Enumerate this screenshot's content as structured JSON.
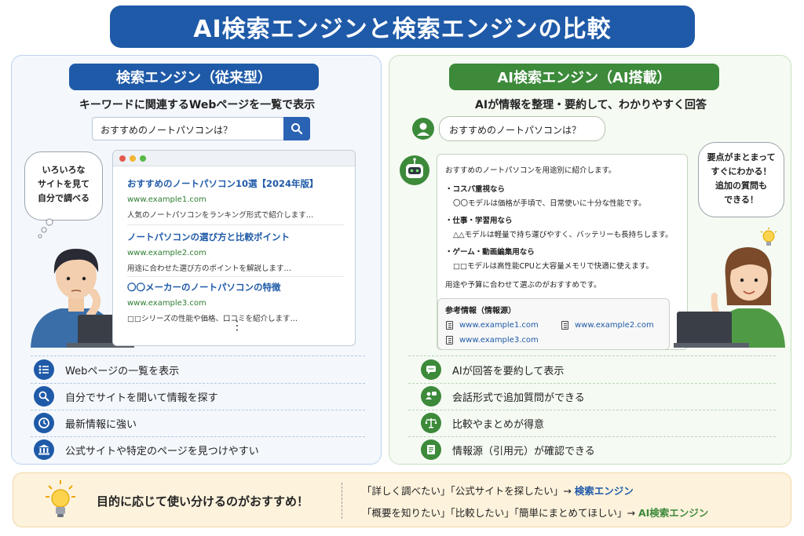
{
  "title": "AI検索エンジンと検索エンジンの比較",
  "left": {
    "heading": "検索エンジン（従来型）",
    "subtitle": "キーワードに関連するWebページを一覧で表示",
    "search_query": "おすすめのノートパソコンは？",
    "bubble": [
      "いろいろな",
      "サイトを見て",
      "自分で調べる"
    ],
    "results": [
      {
        "title": "おすすめのノートパソコン10選【2024年版】",
        "url": "www.example1.com",
        "desc": "人気のノートパソコンをランキング形式で紹介します…"
      },
      {
        "title": "ノートパソコンの選び方と比較ポイント",
        "url": "www.example2.com",
        "desc": "用途に合わせた選び方のポイントを解説します…"
      },
      {
        "title": "〇〇メーカーのノートパソコンの特徴",
        "url": "www.example3.com",
        "desc": "□□シリーズの性能や価格、口コミを紹介します…"
      }
    ],
    "more_glyph": "⋮",
    "features": [
      {
        "icon": "list-icon",
        "text": "Webページの一覧を表示"
      },
      {
        "icon": "search-icon",
        "text": "自分でサイトを開いて情報を探す"
      },
      {
        "icon": "clock-icon",
        "text": "最新情報に強い"
      },
      {
        "icon": "building-icon",
        "text": "公式サイトや特定のページを見つけやすい"
      }
    ]
  },
  "right": {
    "heading": "AI検索エンジン（AI搭載）",
    "subtitle": "AIが情報を整理・要約して、わかりやすく回答",
    "user_question": "おすすめのノートパソコンは？",
    "bubble": [
      "要点がまとまって",
      "すぐにわかる！",
      "追加の質問も",
      "できる！"
    ],
    "answer": {
      "intro": "おすすめのノートパソコンを用途別に紹介します。",
      "sections": [
        {
          "head": "・コスパ重視なら",
          "body": "〇〇モデルは価格が手頃で、日常使いに十分な性能です。"
        },
        {
          "head": "・仕事・学習用なら",
          "body": "△△モデルは軽量で持ち運びやすく、バッテリーも長持ちします。"
        },
        {
          "head": "・ゲーム・動画編集用なら",
          "body": "□□モデルは高性能CPUと大容量メモリで快適に使えます。"
        }
      ],
      "closing": "用途や予算に合わせて選ぶのがおすすめです。",
      "sources_title": "参考情報（情報源）",
      "sources": [
        "www.example1.com",
        "www.example2.com",
        "www.example3.com"
      ]
    },
    "features": [
      {
        "icon": "chat-icon",
        "text": "AIが回答を要約して表示"
      },
      {
        "icon": "conversation-icon",
        "text": "会話形式で追加質問ができる"
      },
      {
        "icon": "scale-icon",
        "text": "比較やまとめが得意"
      },
      {
        "icon": "document-icon",
        "text": "情報源（引用元）が確認できる"
      }
    ]
  },
  "banner": {
    "main": "目的に応じて使い分けるのがおすすめ！",
    "line1_prefix": "「詳しく調べたい」「公式サイトを探したい」→",
    "line1_target": "検索エンジン",
    "line2_prefix": "「概要を知りたい」「比較したい」「簡単にまとめてほしい」→",
    "line2_target": "AI検索エンジン"
  },
  "colors": {
    "primary_blue": "#1f5aa8",
    "primary_green": "#3c8a3a",
    "banner_bg": "#fdf2dc"
  }
}
